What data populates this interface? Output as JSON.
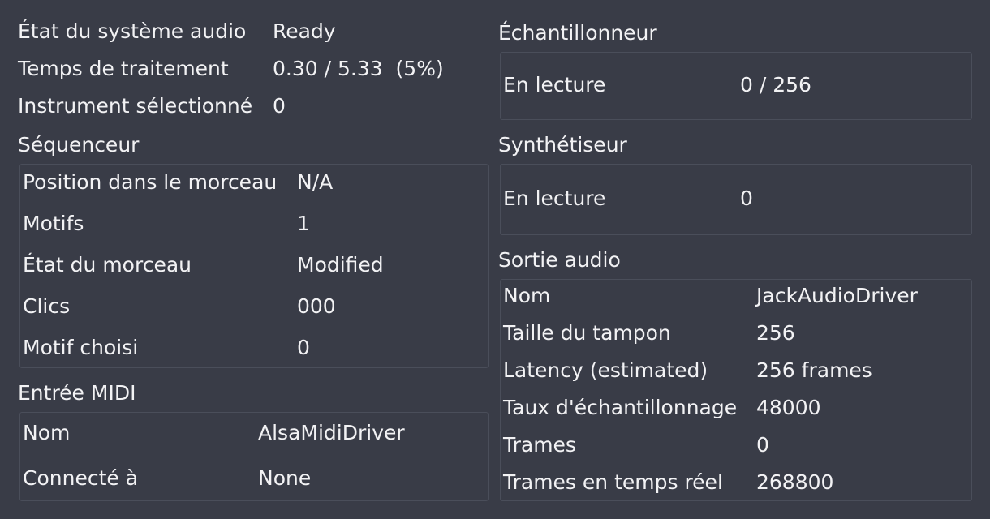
{
  "general": {
    "audio_state": {
      "label": "État du système audio",
      "value": "Ready"
    },
    "processing_time": {
      "label": "Temps de traitement",
      "value": "0.30 / 5.33  (5%)"
    },
    "selected_instrument": {
      "label": "Instrument sélectionné",
      "value": "0"
    }
  },
  "sequencer": {
    "title": "Séquenceur",
    "rows": [
      {
        "label": "Position dans le morceau",
        "value": "N/A"
      },
      {
        "label": "Motifs",
        "value": "1"
      },
      {
        "label": "État du morceau",
        "value": "Modified"
      },
      {
        "label": "Clics",
        "value": "000"
      },
      {
        "label": "Motif choisi",
        "value": "0"
      }
    ]
  },
  "midi_input": {
    "title": "Entrée MIDI",
    "rows": [
      {
        "label": "Nom",
        "value": "AlsaMidiDriver"
      },
      {
        "label": "Connecté à",
        "value": "None"
      }
    ]
  },
  "sampler": {
    "title": "Échantillonneur",
    "rows": [
      {
        "label": "En lecture",
        "value": "0 / 256"
      }
    ]
  },
  "synth": {
    "title": "Synthétiseur",
    "rows": [
      {
        "label": "En lecture",
        "value": "0"
      }
    ]
  },
  "audio_output": {
    "title": "Sortie audio",
    "rows": [
      {
        "label": "Nom",
        "value": "JackAudioDriver"
      },
      {
        "label": "Taille du tampon",
        "value": "256"
      },
      {
        "label": "Latency (estimated)",
        "value": "256 frames"
      },
      {
        "label": "Taux d'échantillonnage",
        "value": "48000"
      },
      {
        "label": "Trames",
        "value": "0"
      },
      {
        "label": "Trames en temps réel",
        "value": "268800"
      }
    ]
  }
}
